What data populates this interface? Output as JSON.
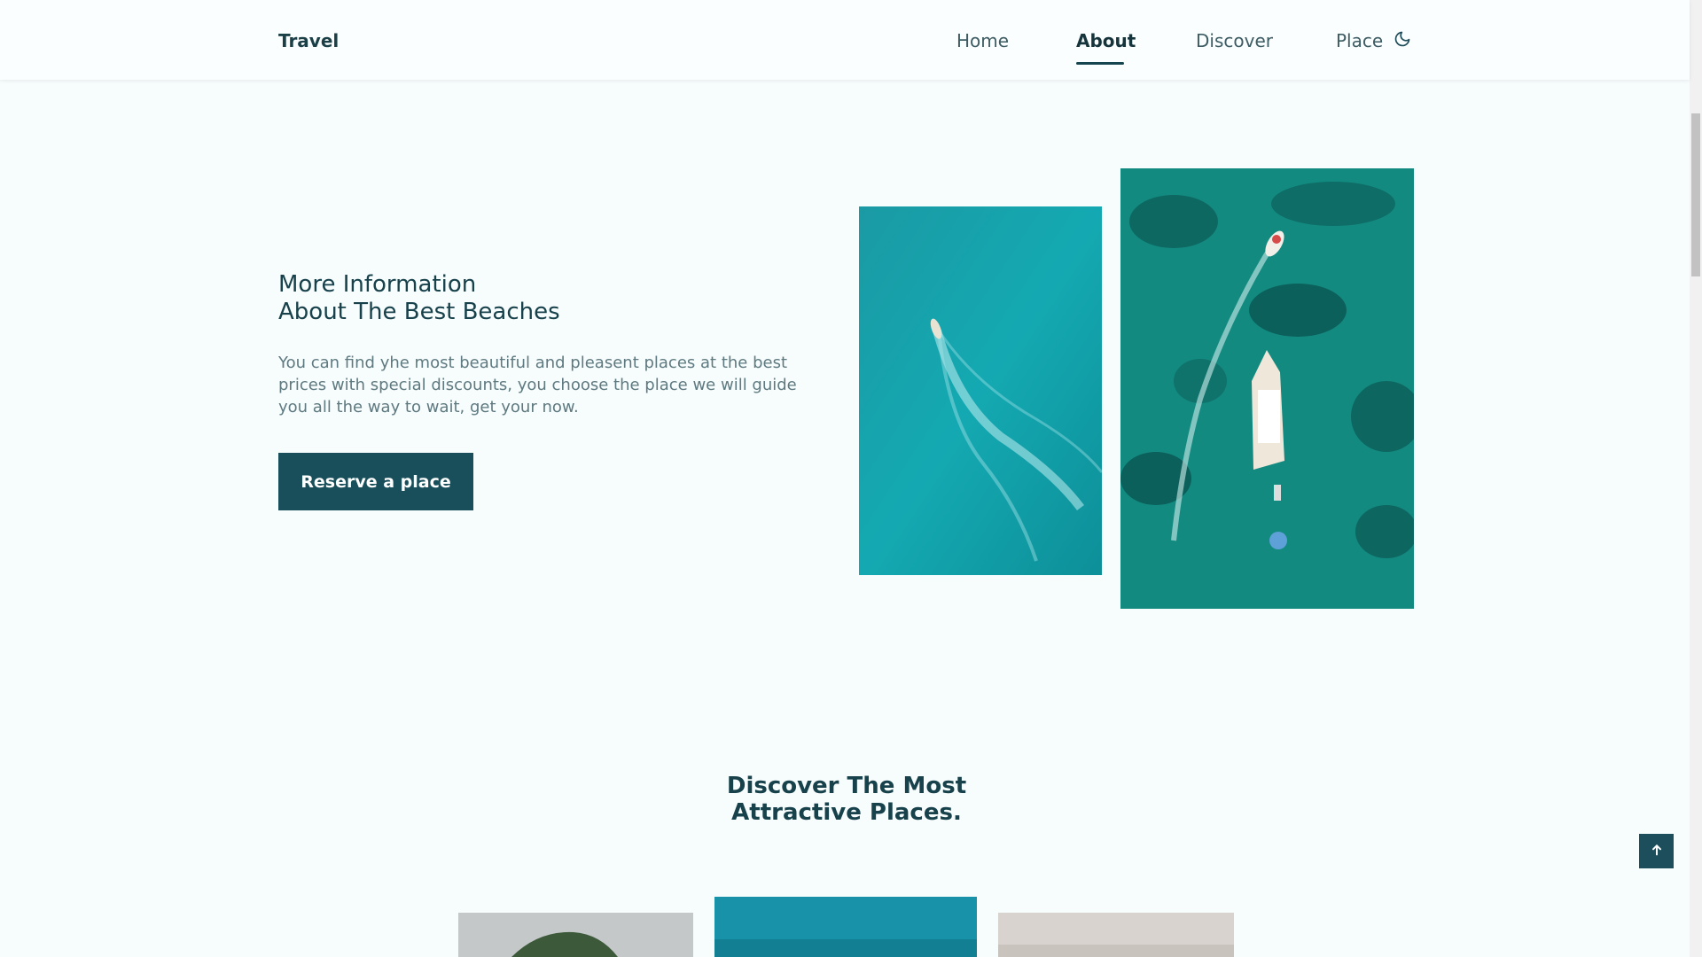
{
  "header": {
    "logo": "Travel",
    "nav": [
      {
        "label": "Home",
        "active": false
      },
      {
        "label": "About",
        "active": true
      },
      {
        "label": "Discover",
        "active": false
      },
      {
        "label": "Place",
        "active": false
      }
    ],
    "theme_icon": "moon-icon"
  },
  "about": {
    "title_line1": "More Information",
    "title_line2": "About The Best Beaches",
    "description": "You can find yhe most beautiful and pleasent places at the best prices with special discounts, you choose the place we will guide you all the way to wait, get your now.",
    "button_label": "Reserve a place"
  },
  "discover": {
    "title_line1": "Discover The Most",
    "title_line2": "Attractive Places."
  },
  "scroll_top_icon": "arrow-up-icon",
  "colors": {
    "primary": "#184f5a",
    "background": "#f7fcfd",
    "text_dark": "#17414b",
    "text_muted": "#5e7a80"
  }
}
